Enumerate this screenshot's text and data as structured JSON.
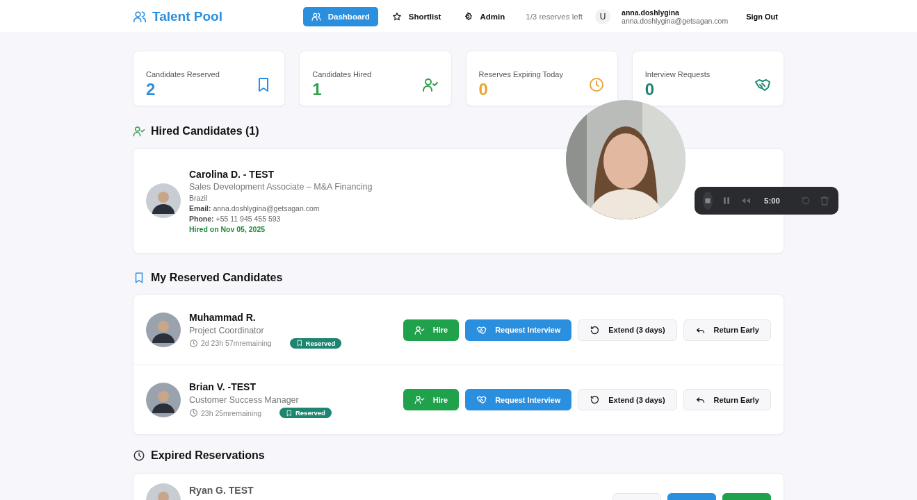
{
  "header": {
    "logo": "Talent Pool",
    "nav": [
      {
        "label": "Dashboard",
        "kind": "users",
        "selected": true
      },
      {
        "label": "Shortlist",
        "kind": "star",
        "selected": false
      },
      {
        "label": "Admin",
        "kind": "gear",
        "selected": false
      }
    ],
    "reserves_left": "1/3 reserves left",
    "user": {
      "initial": "U",
      "name": "anna.doshlygina",
      "email": "anna.doshlygina@getsagan.com"
    },
    "sign_out": "Sign Out"
  },
  "stats": [
    {
      "label": "Candidates Reserved",
      "value": "2",
      "kind": "bookmark",
      "color": "#2b8fe0"
    },
    {
      "label": "Candidates Hired",
      "value": "1",
      "kind": "user-check",
      "color": "#2fa14a"
    },
    {
      "label": "Reserves Expiring Today",
      "value": "0",
      "kind": "clock",
      "color": "#e9a530"
    },
    {
      "label": "Interview Requests",
      "value": "0",
      "kind": "handshake",
      "color": "#1e8571"
    }
  ],
  "hired": {
    "title": "Hired Candidates (1)",
    "candidates": [
      {
        "name": "Carolina D. - TEST",
        "role": "Sales Development Associate – M&A Financing",
        "country": "Brazil",
        "email_label": "Email:",
        "email": "anna.doshlygina@getsagan.com",
        "phone_label": "Phone:",
        "phone": "+55 11 945 455 593",
        "hired": "Hired on Nov 05, 2025"
      }
    ]
  },
  "reserved": {
    "title": "My Reserved Candidates",
    "candidates": [
      {
        "name": "Muhammad R.",
        "role": "Project Coordinator",
        "remaining": "2d 23h 57mremaining",
        "badge": "Reserved",
        "actions": [
          {
            "kind": "hire",
            "label": "Hire"
          },
          {
            "kind": "interview",
            "label": "Request Interview"
          },
          {
            "kind": "extend",
            "label": "Extend (3 days)"
          },
          {
            "kind": "return",
            "label": "Return Early"
          }
        ]
      },
      {
        "name": "Brian V. -TEST",
        "role": "Customer Success Manager",
        "remaining": "23h 25mremaining",
        "badge": "Reserved",
        "actions": [
          {
            "kind": "hire",
            "label": "Hire"
          },
          {
            "kind": "interview",
            "label": "Request Interview"
          },
          {
            "kind": "extend",
            "label": "Extend (3 days)"
          },
          {
            "kind": "return",
            "label": "Return Early"
          }
        ]
      }
    ]
  },
  "expired": {
    "title": "Expired Reservations",
    "candidates": [
      {
        "name": "Ryan G. TEST",
        "actions": [
          {
            "kind": "secondary"
          },
          {
            "kind": "primary"
          },
          {
            "kind": "success"
          }
        ]
      }
    ]
  },
  "recorder": {
    "time": "5:00"
  }
}
